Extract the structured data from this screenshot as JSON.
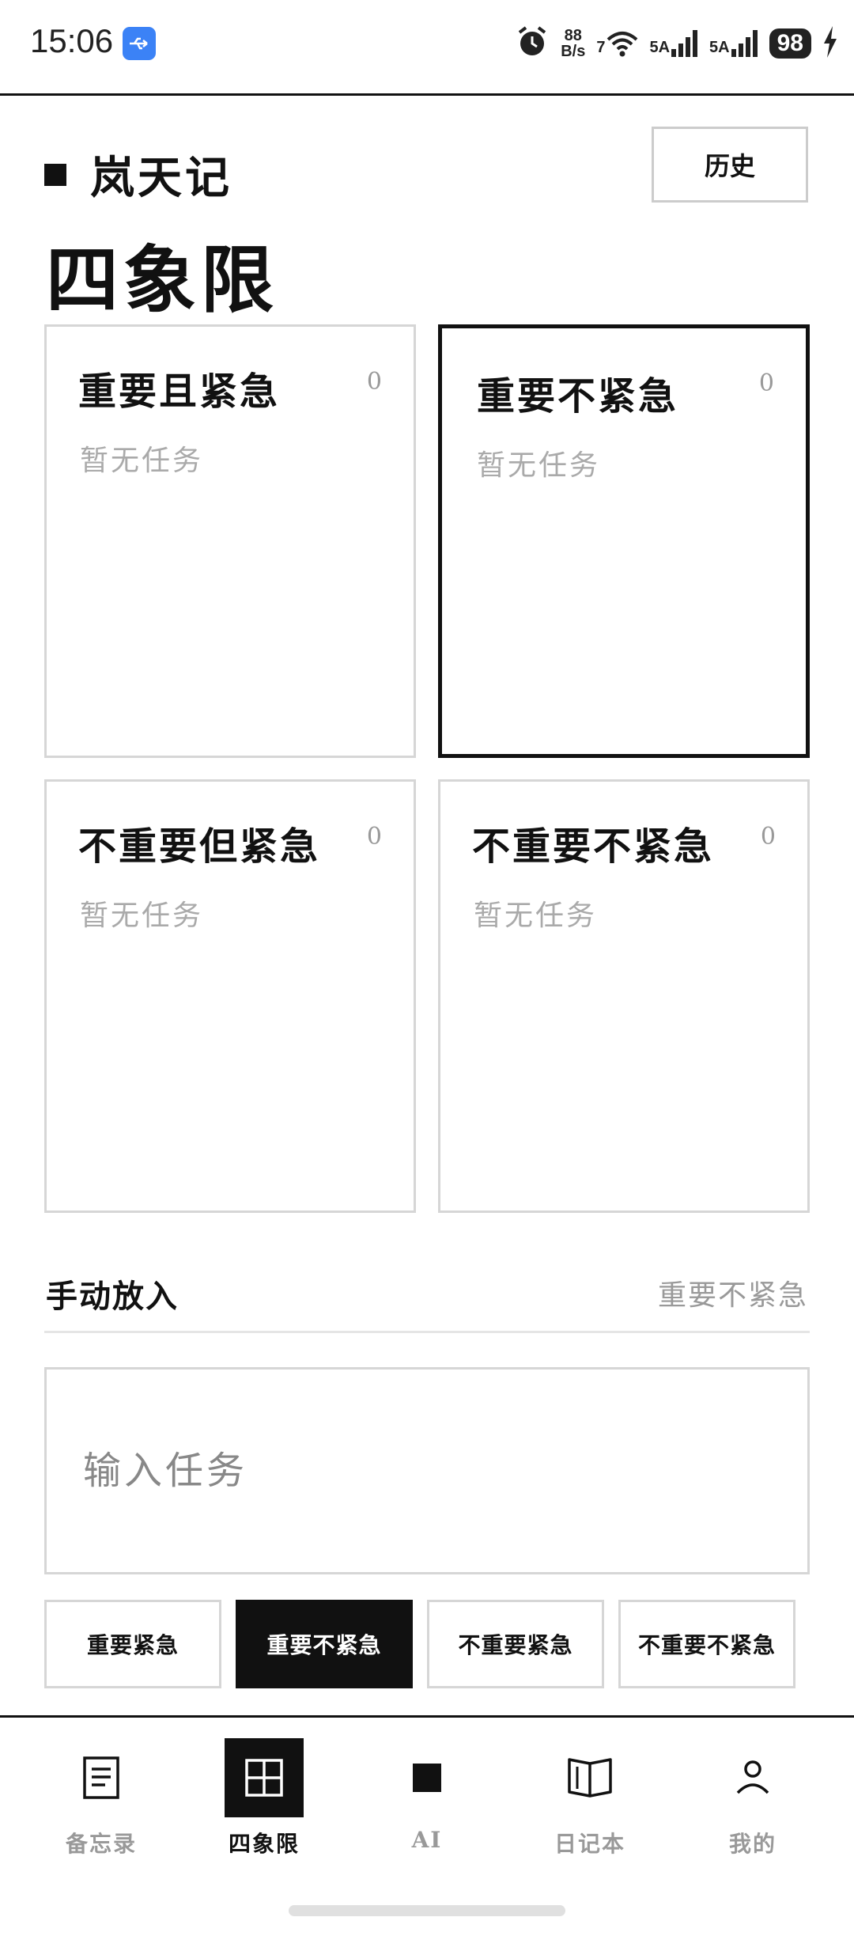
{
  "status_bar": {
    "time": "15:06",
    "net_speed_value": "88",
    "net_speed_unit": "B/s",
    "wifi_label": "7",
    "sim1_label": "5A",
    "sim2_label": "5A",
    "battery": "98"
  },
  "header": {
    "app_name": "岚天记",
    "history_button": "历史",
    "page_title": "四象限"
  },
  "quadrants": [
    {
      "title": "重要且紧急",
      "count": "0",
      "empty_text": "暂无任务"
    },
    {
      "title": "重要不紧急",
      "count": "0",
      "empty_text": "暂无任务"
    },
    {
      "title": "不重要但紧急",
      "count": "0",
      "empty_text": "暂无任务"
    },
    {
      "title": "不重要不紧急",
      "count": "0",
      "empty_text": "暂无任务"
    }
  ],
  "manual": {
    "label": "手动放入",
    "target": "重要不紧急",
    "input_placeholder": "输入任务"
  },
  "chips": [
    "重要紧急",
    "重要不紧急",
    "不重要紧急",
    "不重要不紧急"
  ],
  "nav": [
    {
      "label": "备忘录",
      "icon": "document-icon"
    },
    {
      "label": "四象限",
      "icon": "grid-icon"
    },
    {
      "label": "AI",
      "icon": "square-icon"
    },
    {
      "label": "日记本",
      "icon": "book-icon"
    },
    {
      "label": "我的",
      "icon": "person-icon"
    }
  ],
  "colors": {
    "accent": "#111111",
    "muted": "#999999",
    "border": "#d6d6d6"
  }
}
